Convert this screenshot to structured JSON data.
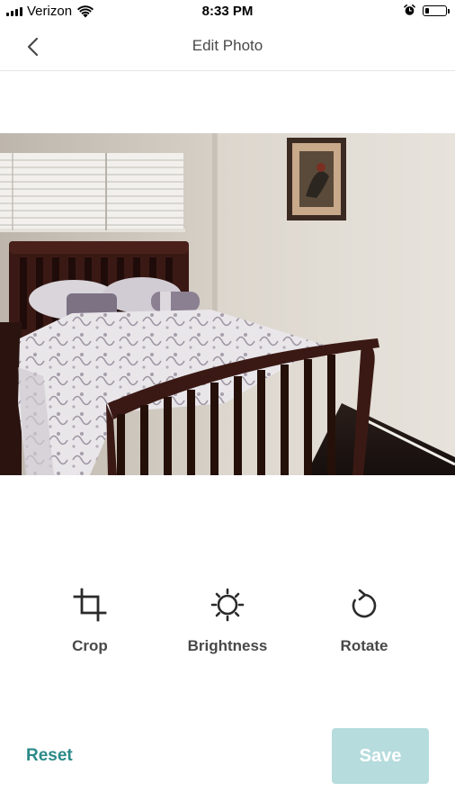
{
  "status_bar": {
    "carrier": "Verizon",
    "time": "8:33 PM",
    "battery_level": 0.2
  },
  "nav": {
    "title": "Edit Photo",
    "back_icon": "chevron-left-icon"
  },
  "photo": {
    "subject": "bedroom photo"
  },
  "tools": [
    {
      "label": "Crop",
      "icon": "crop-icon"
    },
    {
      "label": "Brightness",
      "icon": "brightness-icon"
    },
    {
      "label": "Rotate",
      "icon": "rotate-icon"
    }
  ],
  "footer": {
    "reset_label": "Reset",
    "save_label": "Save"
  },
  "colors": {
    "accent": "#2b8a89",
    "save_disabled_bg": "#b6dcdd"
  }
}
